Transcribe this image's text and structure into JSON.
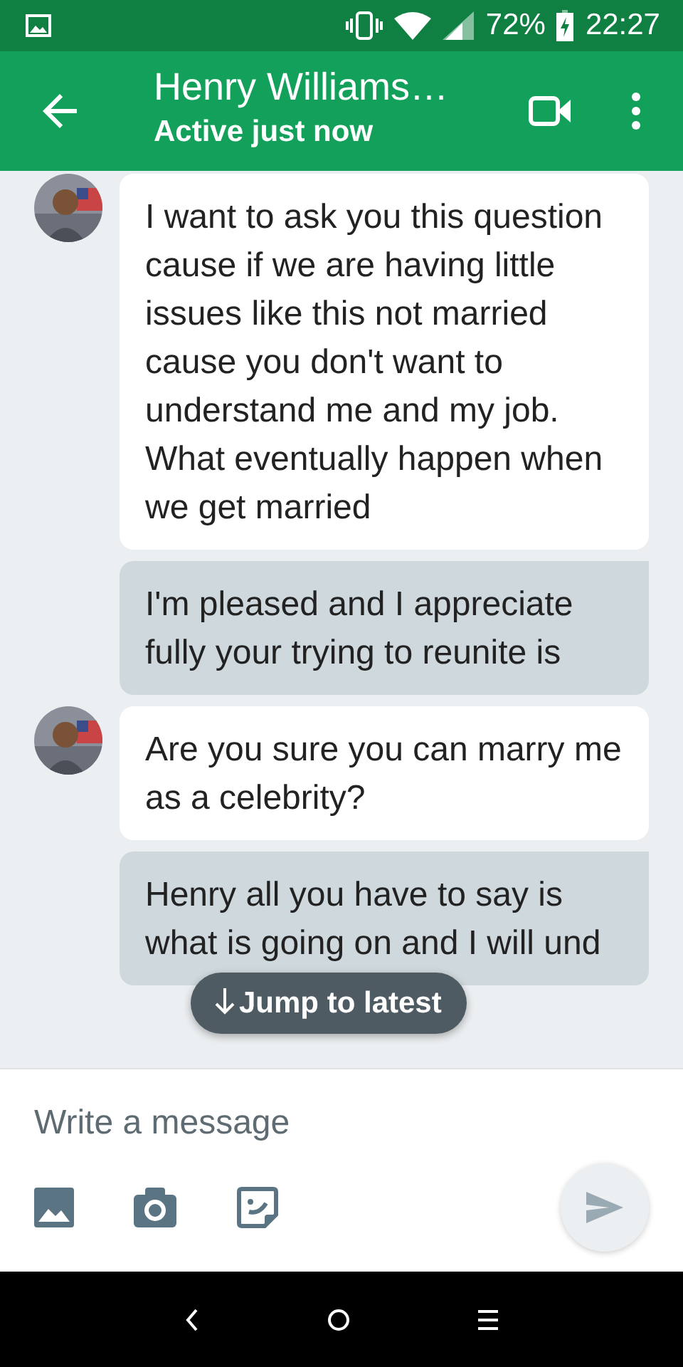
{
  "status_bar": {
    "battery": "72%",
    "time": "22:27"
  },
  "header": {
    "title": "Henry Williams…",
    "subtitle": "Active just now"
  },
  "messages": [
    {
      "kind": "received",
      "text": "I want to ask you this question cause if we are having little issues like this not married cause you don't want to understand me and my job. What eventually happen when we get married"
    },
    {
      "kind": "sent",
      "text": "I'm pleased and I appreciate fully your trying to reunite is"
    },
    {
      "kind": "received",
      "text": "Are you sure you can marry me as a celebrity?"
    },
    {
      "kind": "sent",
      "text": "Henry all you have to say is what is going on and I will und"
    }
  ],
  "jump_button": {
    "label": "Jump to latest"
  },
  "composer": {
    "placeholder": "Write a message"
  }
}
